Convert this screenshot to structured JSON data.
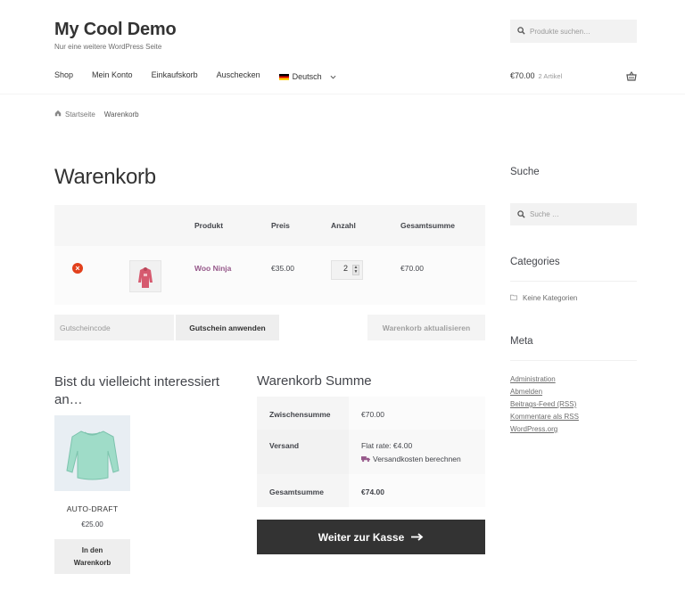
{
  "header": {
    "site_title": "My Cool Demo",
    "tagline": "Nur eine weitere WordPress Seite",
    "search_placeholder": "Produkte suchen…",
    "nav": [
      "Shop",
      "Mein Konto",
      "Einkaufskorb",
      "Auschecken"
    ],
    "language": "Deutsch",
    "cart_total": "€70.00",
    "cart_count": "2 Artikel"
  },
  "breadcrumb": {
    "home": "Startseite",
    "current": "Warenkorb"
  },
  "page_title": "Warenkorb",
  "cart": {
    "columns": {
      "product": "Produkt",
      "price": "Preis",
      "quantity": "Anzahl",
      "subtotal": "Gesamtsumme"
    },
    "items": [
      {
        "name": "Woo Ninja",
        "price": "€35.00",
        "quantity": "2",
        "subtotal": "€70.00"
      }
    ],
    "coupon_placeholder": "Gutscheincode",
    "apply_coupon": "Gutschein anwenden",
    "update_cart": "Warenkorb aktualisieren"
  },
  "cross_sells": {
    "title": "Bist du vielleicht interessiert an…",
    "products": [
      {
        "name": "AUTO-DRAFT",
        "price": "€25.00",
        "button": "In den Warenkorb"
      }
    ]
  },
  "totals": {
    "title": "Warenkorb Summe",
    "subtotal_label": "Zwischensumme",
    "subtotal_value": "€70.00",
    "shipping_label": "Versand",
    "shipping_value": "Flat rate: €4.00",
    "shipping_calc": "Versandkosten berechnen",
    "total_label": "Gesamtsumme",
    "total_value": "€74.00",
    "checkout": "Weiter zur Kasse"
  },
  "sidebar": {
    "search_title": "Suche",
    "search_placeholder": "Suche …",
    "categories_title": "Categories",
    "no_categories": "Keine Kategorien",
    "meta_title": "Meta",
    "meta_links": [
      "Administration",
      "Abmelden",
      "Beitrags-Feed (RSS)",
      "Kommentare als RSS",
      "WordPress.org"
    ]
  },
  "colors": {
    "accent": "#96588a",
    "remove": "#e2401c",
    "checkout_bg": "#333333"
  }
}
